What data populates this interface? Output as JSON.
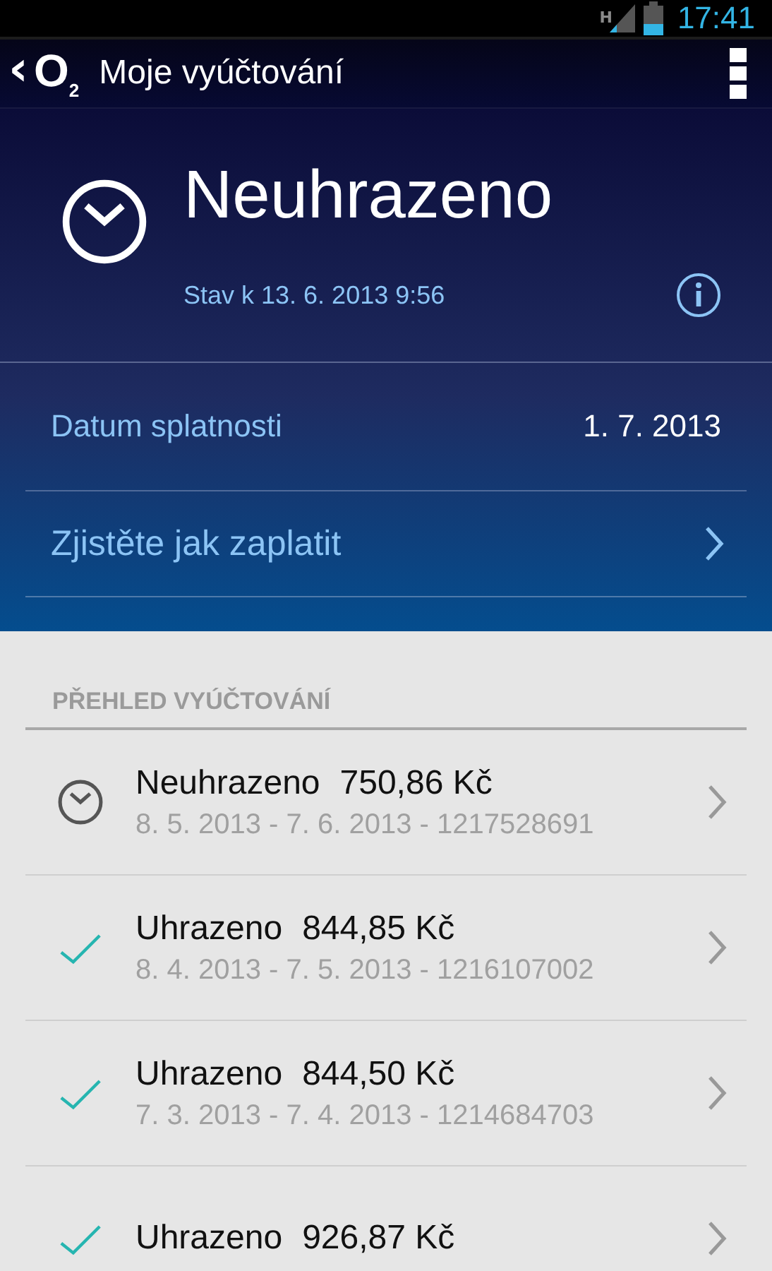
{
  "status_bar": {
    "network": "H",
    "time": "17:41"
  },
  "action_bar": {
    "back": "‹",
    "logo": "O$_{2}$",
    "title": "Moje vyúčtování"
  },
  "summary": {
    "kind": "pending",
    "status": "Neuhrazeno",
    "timestamp": "Stav k 13. 6. 2013 9:56",
    "due_label": "Datum splatnosti",
    "due_date": "1. 7. 2013",
    "pay_link": "Zjistěte jak zaplatit"
  },
  "overview": {
    "heading": "PŘEHLED VYÚČTOVÁNÍ",
    "items": [
      {
        "kind": "pending",
        "status": "Neuhrazeno",
        "amount": "750,86 Kč",
        "details": "8. 5. 2013 - 7. 6. 2013 - 1217528691"
      },
      {
        "kind": "paid",
        "status": "Uhrazeno",
        "amount": "844,85 Kč",
        "details": "8. 4. 2013 - 7. 5. 2013 - 1216107002"
      },
      {
        "kind": "paid",
        "status": "Uhrazeno",
        "amount": "844,50 Kč",
        "details": "7. 3. 2013 - 7. 4. 2013 - 1214684703"
      },
      {
        "kind": "paid",
        "status": "Uhrazeno",
        "amount": "926,87 Kč"
      }
    ]
  }
}
